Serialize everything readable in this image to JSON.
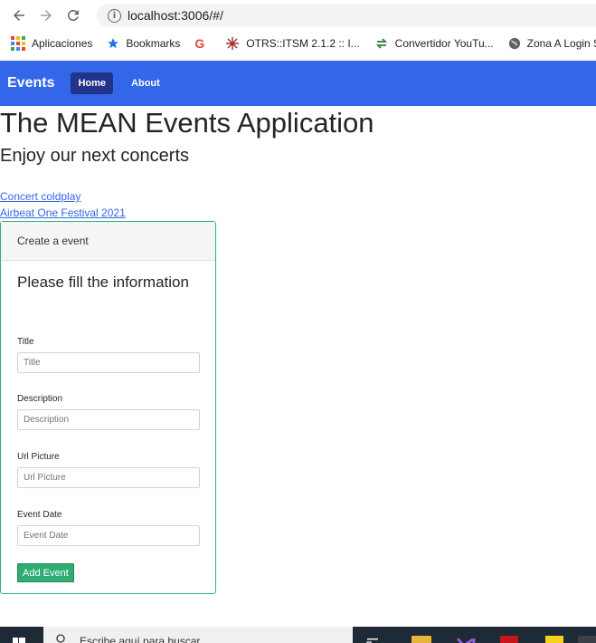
{
  "browser": {
    "url": "localhost:3006/#/",
    "bookmarks": [
      {
        "label": "Aplicaciones",
        "icon": "apps-grid-icon"
      },
      {
        "label": "Bookmarks",
        "icon": "star-icon"
      },
      {
        "label": "",
        "icon": "google-icon"
      },
      {
        "label": "OTRS::ITSM 2.1.2 :: I...",
        "icon": "otrs-icon"
      },
      {
        "label": "Convertidor YouTu...",
        "icon": "convert-icon"
      },
      {
        "label": "Zona A Login SV",
        "icon": "globe-icon"
      }
    ]
  },
  "navbar": {
    "brand": "Events",
    "links": [
      "Home",
      "About"
    ],
    "active": "Home",
    "color": "#3366e8",
    "active_color": "#22338a"
  },
  "main": {
    "title": "The MEAN Events Application",
    "subtitle": "Enjoy our next concerts",
    "events": [
      "Concert coldplay",
      "Airbeat One Festival 2021"
    ]
  },
  "form": {
    "header": "Create a event",
    "heading": "Please fill the information",
    "fields": [
      {
        "label": "Title",
        "placeholder": "Title"
      },
      {
        "label": "Description",
        "placeholder": "Description"
      },
      {
        "label": "Url Picture",
        "placeholder": "Url Picture"
      },
      {
        "label": "Event Date",
        "placeholder": "Event Date"
      }
    ],
    "submit": "Add Event",
    "accent_color": "#2fad73"
  },
  "taskbar": {
    "search_placeholder": "Escribe aquí para buscar"
  }
}
